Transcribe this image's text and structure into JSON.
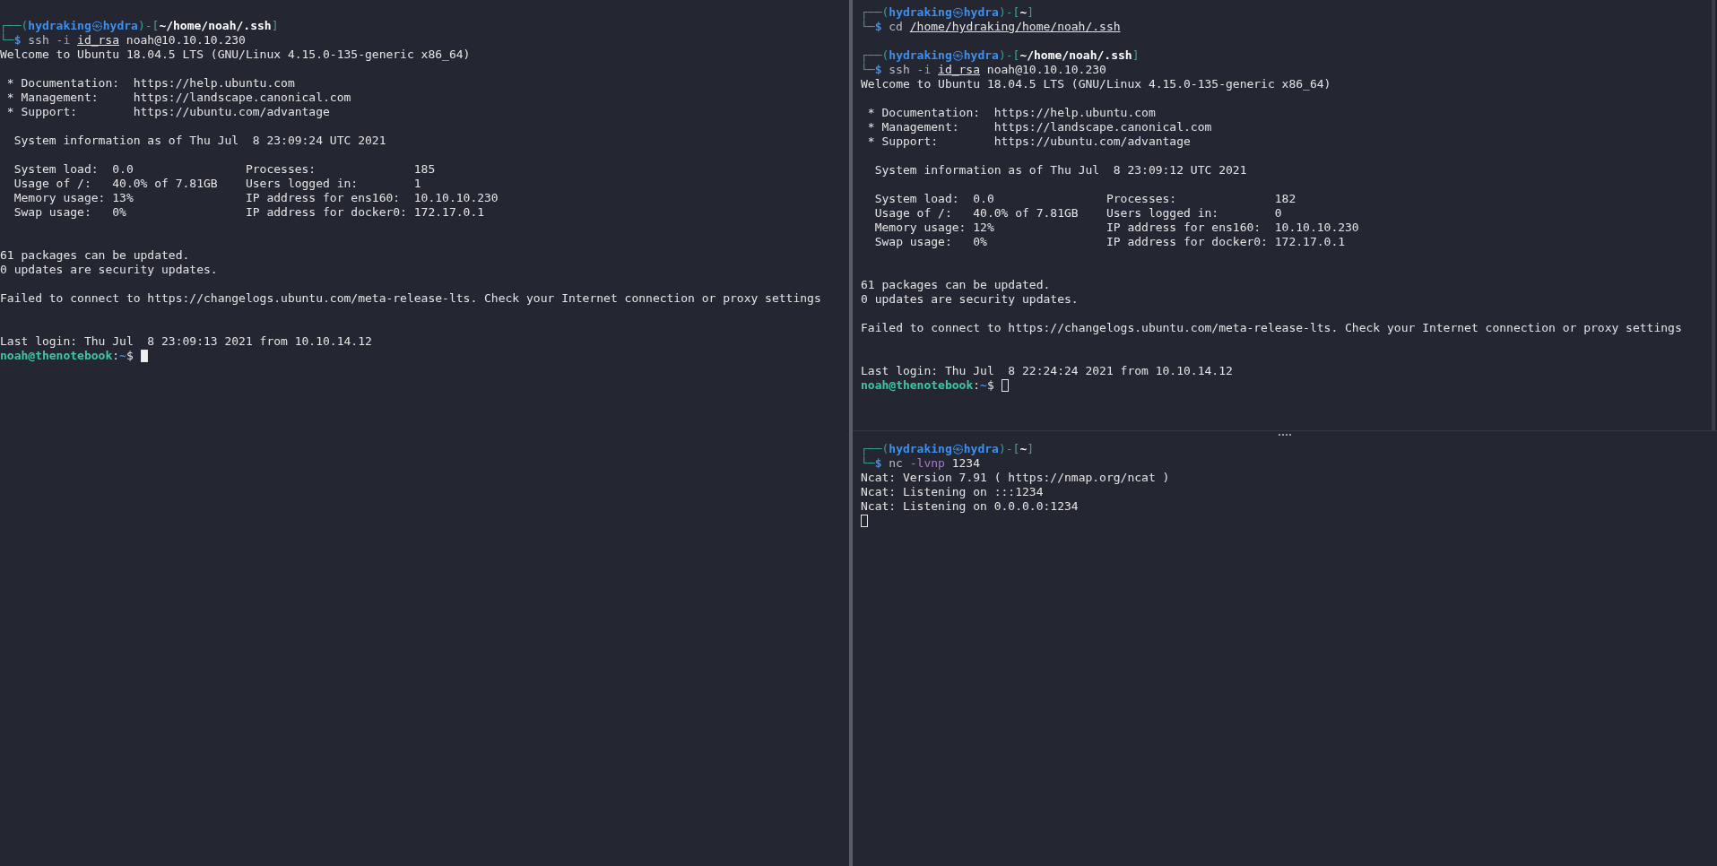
{
  "left_pane": {
    "lines": [
      {
        "kind": "blank"
      },
      {
        "kind": "prompt",
        "frame": [
          "┌──(",
          ")-[",
          "]",
          "└─"
        ],
        "user": "hydraking",
        "at": "㉿",
        "host": "hydra",
        "path": "~/home/noah/.ssh",
        "sign": "$",
        "command": [
          {
            "kind": "command",
            "text": "ssh"
          },
          {
            "kind": "option",
            "text": "-i"
          },
          {
            "kind": "path",
            "text": "id_rsa"
          },
          {
            "kind": "argument",
            "text": "noah@10.10.10.230"
          }
        ]
      },
      {
        "kind": "text",
        "text": "Welcome to Ubuntu 18.04.5 LTS (GNU/Linux 4.15.0-135-generic x86_64)"
      },
      {
        "kind": "blank"
      },
      {
        "kind": "text",
        "text": " * Documentation:  https://help.ubuntu.com"
      },
      {
        "kind": "text",
        "text": " * Management:     https://landscape.canonical.com"
      },
      {
        "kind": "text",
        "text": " * Support:        https://ubuntu.com/advantage"
      },
      {
        "kind": "blank"
      },
      {
        "kind": "text",
        "text": "  System information as of Thu Jul  8 23:09:24 UTC 2021"
      },
      {
        "kind": "blank"
      },
      {
        "kind": "text",
        "text": "  System load:  0.0                Processes:              185"
      },
      {
        "kind": "text",
        "text": "  Usage of /:   40.0% of 7.81GB    Users logged in:        1"
      },
      {
        "kind": "text",
        "text": "  Memory usage: 13%                IP address for ens160:  10.10.10.230"
      },
      {
        "kind": "text",
        "text": "  Swap usage:   0%                 IP address for docker0: 172.17.0.1"
      },
      {
        "kind": "blank"
      },
      {
        "kind": "blank"
      },
      {
        "kind": "text",
        "text": "61 packages can be updated."
      },
      {
        "kind": "text",
        "text": "0 updates are security updates."
      },
      {
        "kind": "blank"
      },
      {
        "kind": "text",
        "text": "Failed to connect to https://changelogs.ubuntu.com/meta-release-lts. Check your Internet connection or proxy settings"
      },
      {
        "kind": "blank"
      },
      {
        "kind": "blank"
      },
      {
        "kind": "text",
        "text": "Last login: Thu Jul  8 23:09:13 2021 from 10.10.14.12"
      },
      {
        "kind": "shell",
        "user": "noah@thenotebook",
        "sep": ":",
        "path": "~",
        "sign": "$",
        "focused": true
      }
    ]
  },
  "right_top_pane": {
    "lines": [
      {
        "kind": "prompt",
        "frame": [
          "┌──(",
          ")-[",
          "]",
          "└─"
        ],
        "user": "hydraking",
        "at": "㉿",
        "host": "hydra",
        "path": "~",
        "sign": "$",
        "command": [
          {
            "kind": "command",
            "text": "cd"
          },
          {
            "kind": "path",
            "text": "/home/hydraking/home/noah/.ssh"
          }
        ]
      },
      {
        "kind": "blank"
      },
      {
        "kind": "prompt",
        "frame": [
          "┌──(",
          ")-[",
          "]",
          "└─"
        ],
        "user": "hydraking",
        "at": "㉿",
        "host": "hydra",
        "path": "~/home/noah/.ssh",
        "sign": "$",
        "command": [
          {
            "kind": "command",
            "text": "ssh"
          },
          {
            "kind": "option",
            "text": "-i"
          },
          {
            "kind": "path",
            "text": "id_rsa"
          },
          {
            "kind": "argument",
            "text": "noah@10.10.10.230"
          }
        ]
      },
      {
        "kind": "text",
        "text": "Welcome to Ubuntu 18.04.5 LTS (GNU/Linux 4.15.0-135-generic x86_64)"
      },
      {
        "kind": "blank"
      },
      {
        "kind": "text",
        "text": " * Documentation:  https://help.ubuntu.com"
      },
      {
        "kind": "text",
        "text": " * Management:     https://landscape.canonical.com"
      },
      {
        "kind": "text",
        "text": " * Support:        https://ubuntu.com/advantage"
      },
      {
        "kind": "blank"
      },
      {
        "kind": "text",
        "text": "  System information as of Thu Jul  8 23:09:12 UTC 2021"
      },
      {
        "kind": "blank"
      },
      {
        "kind": "text",
        "text": "  System load:  0.0                Processes:              182"
      },
      {
        "kind": "text",
        "text": "  Usage of /:   40.0% of 7.81GB    Users logged in:        0"
      },
      {
        "kind": "text",
        "text": "  Memory usage: 12%                IP address for ens160:  10.10.10.230"
      },
      {
        "kind": "text",
        "text": "  Swap usage:   0%                 IP address for docker0: 172.17.0.1"
      },
      {
        "kind": "blank"
      },
      {
        "kind": "blank"
      },
      {
        "kind": "text",
        "text": "61 packages can be updated."
      },
      {
        "kind": "text",
        "text": "0 updates are security updates."
      },
      {
        "kind": "blank"
      },
      {
        "kind": "text",
        "text": "Failed to connect to https://changelogs.ubuntu.com/meta-release-lts. Check your Internet connection or proxy settings"
      },
      {
        "kind": "blank"
      },
      {
        "kind": "blank"
      },
      {
        "kind": "text",
        "text": "Last login: Thu Jul  8 22:24:24 2021 from 10.10.14.12"
      },
      {
        "kind": "shell",
        "user": "noah@thenotebook",
        "sep": ":",
        "path": "~",
        "sign": "$",
        "focused": false
      }
    ]
  },
  "right_bottom_pane": {
    "lines": [
      {
        "kind": "prompt",
        "frame": [
          "┌──(",
          ")-[",
          "]",
          "└─"
        ],
        "user": "hydraking",
        "at": "㉿",
        "host": "hydra",
        "path": "~",
        "sign": "$",
        "command": [
          {
            "kind": "command",
            "text": "nc"
          },
          {
            "kind": "flag",
            "text": "-lvnp"
          },
          {
            "kind": "argument",
            "text": "1234"
          }
        ]
      },
      {
        "kind": "text",
        "text": "Ncat: Version 7.91 ( https://nmap.org/ncat )"
      },
      {
        "kind": "text",
        "text": "Ncat: Listening on :::1234"
      },
      {
        "kind": "text",
        "text": "Ncat: Listening on 0.0.0.0:1234"
      },
      {
        "kind": "cursor",
        "focused": false
      }
    ]
  }
}
